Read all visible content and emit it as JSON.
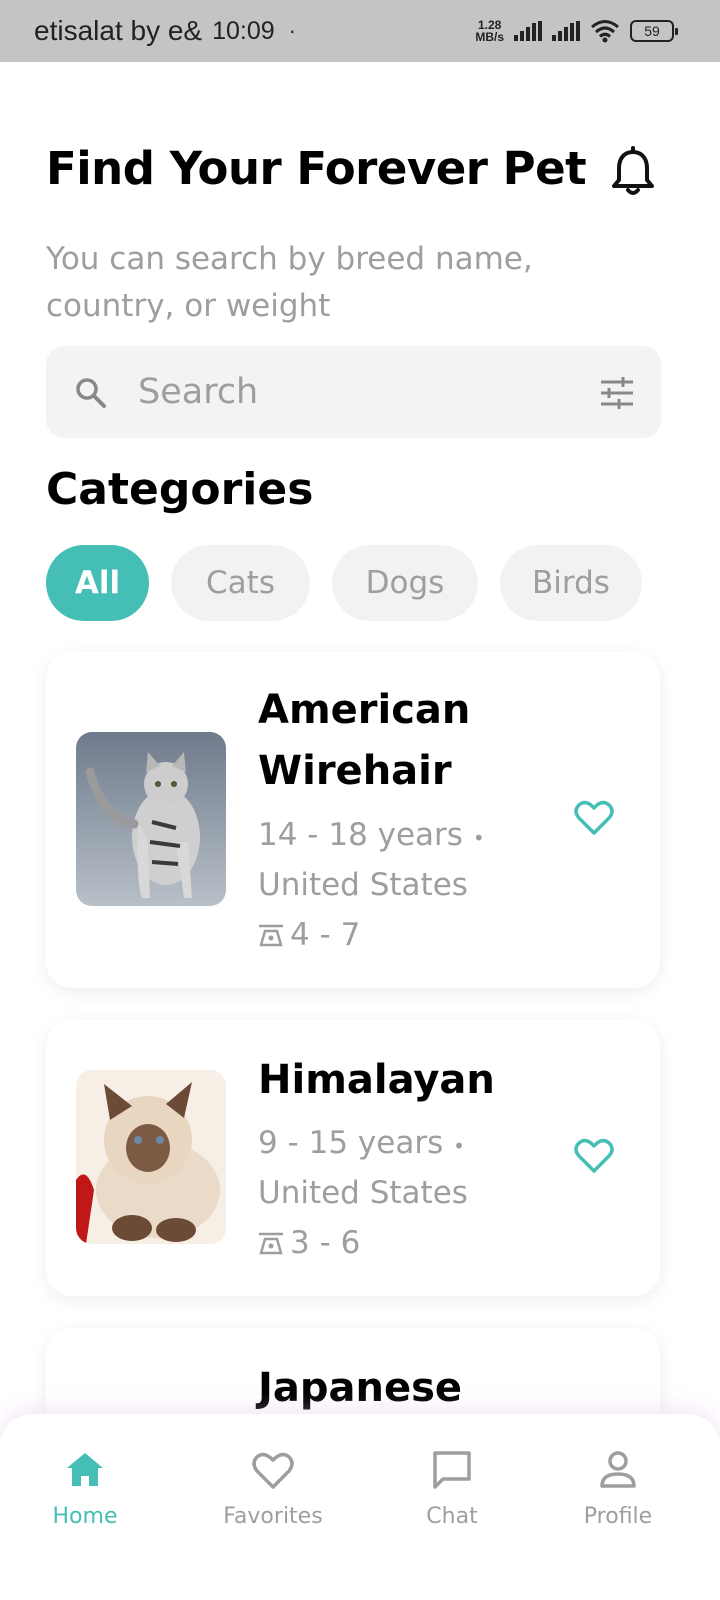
{
  "status_bar": {
    "carrier": "etisalat by e&",
    "time": "10:09",
    "dot": "·",
    "net_speed_value": "1.28",
    "net_speed_unit": "MB/s",
    "battery": "59"
  },
  "header": {
    "title": "Find Your Forever Pet",
    "subtitle": "You can search by breed name, country, or weight"
  },
  "search": {
    "placeholder": "Search"
  },
  "categories": {
    "title": "Categories",
    "items": [
      {
        "label": "All",
        "active": true
      },
      {
        "label": "Cats",
        "active": false
      },
      {
        "label": "Dogs",
        "active": false
      },
      {
        "label": "Birds",
        "active": false
      }
    ]
  },
  "pets": [
    {
      "name": "American Wirehair",
      "lifespan": "14 - 18 years",
      "separator": "•",
      "country": "United States",
      "weight": "4 - 7"
    },
    {
      "name": "Himalayan",
      "lifespan": "9 - 15 years",
      "separator": "•",
      "country": "United States",
      "weight": "3 - 6"
    },
    {
      "name": "Japanese"
    }
  ],
  "nav": {
    "items": [
      {
        "label": "Home",
        "icon": "home-icon",
        "active": true
      },
      {
        "label": "Favorites",
        "icon": "heart-icon",
        "active": false
      },
      {
        "label": "Chat",
        "icon": "chat-icon",
        "active": false
      },
      {
        "label": "Profile",
        "icon": "profile-icon",
        "active": false
      }
    ]
  },
  "colors": {
    "accent": "#45bfb5",
    "muted_text": "#9e9e9e",
    "chip_bg": "#f2f2f2",
    "status_bar": "#c4c4c4"
  }
}
